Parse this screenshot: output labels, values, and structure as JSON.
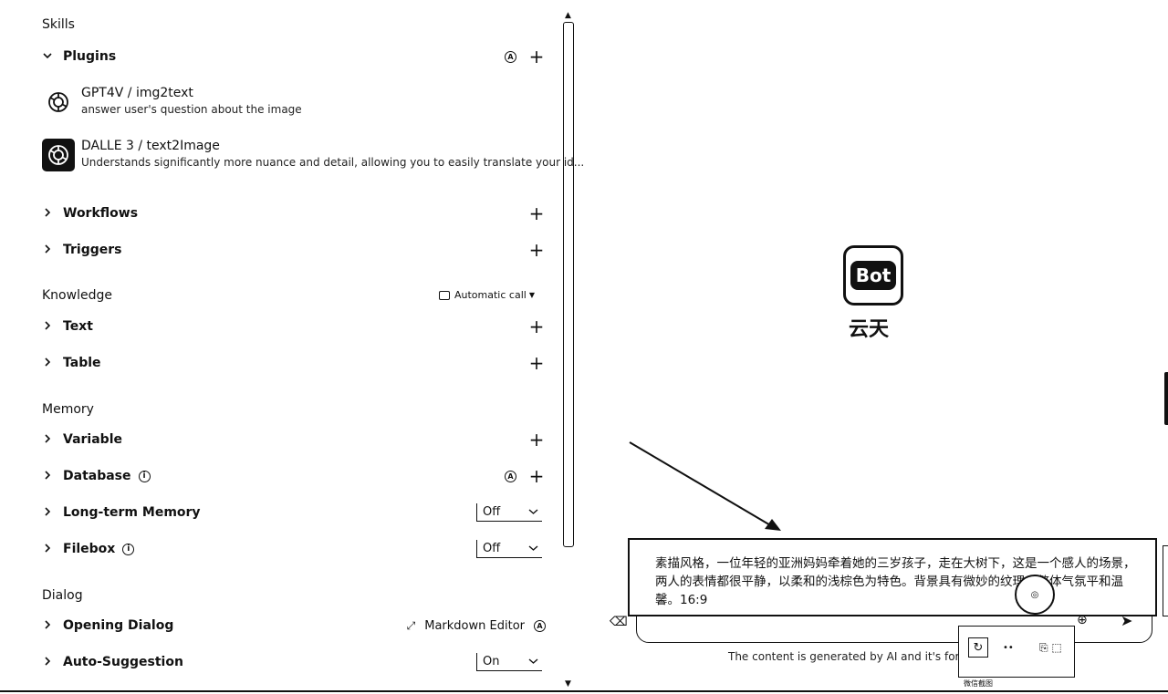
{
  "skills": {
    "title": "Skills",
    "plugins": {
      "label": "Plugins",
      "items": [
        {
          "name": "GPT4V / img2text",
          "desc": "answer user's question about the image"
        },
        {
          "name": "DALLE 3 / text2Image",
          "desc": "Understands significantly more nuance and detail, allowing you to easily translate your id..."
        }
      ]
    },
    "workflows": "Workflows",
    "triggers": "Triggers"
  },
  "knowledge": {
    "title": "Knowledge",
    "auto_call": "Automatic call",
    "text": "Text",
    "table": "Table"
  },
  "memory": {
    "title": "Memory",
    "variable": "Variable",
    "database": "Database",
    "long_term": "Long-term Memory",
    "long_term_value": "Off",
    "filebox": "Filebox",
    "filebox_value": "Off"
  },
  "dialog": {
    "title": "Dialog",
    "opening": "Opening Dialog",
    "markdown_editor": "Markdown Editor",
    "auto_suggestion": "Auto-Suggestion",
    "auto_suggestion_value": "On"
  },
  "bot": {
    "logo_text": "Bot",
    "name": "云天"
  },
  "chat": {
    "prompt": "素描风格，一位年轻的亚洲妈妈牵着她的三岁孩子，走在大树下，这是一个感人的场景，两人的表情都很平静，以柔和的浅棕色为特色。背景具有微妙的纹理，整体气氛平和温馨。16:9",
    "disclaimer": "The content is generated by AI and it's for re"
  },
  "popup": {
    "caption": "微信截图"
  },
  "icons": {
    "plus": "+",
    "chevron_right": "›",
    "chevron_down": "⌄"
  }
}
